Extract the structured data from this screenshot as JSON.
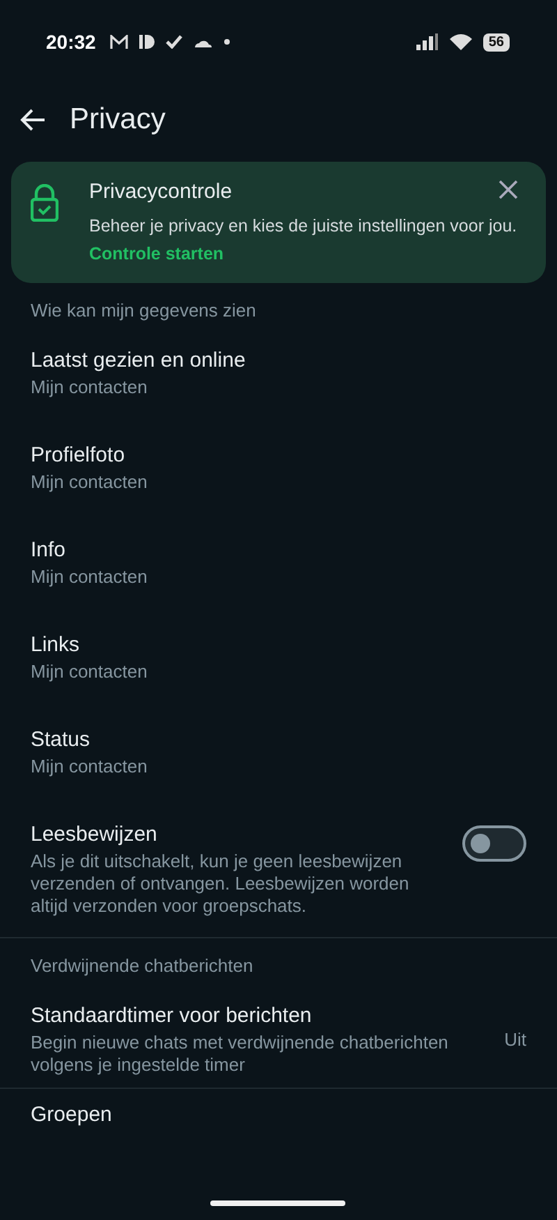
{
  "status_bar": {
    "time": "20:32",
    "battery": "56"
  },
  "header": {
    "title": "Privacy"
  },
  "banner": {
    "title": "Privacycontrole",
    "body": "Beheer je privacy en kies de juiste instellingen voor jou.",
    "link": "Controle starten"
  },
  "sections": [
    {
      "header": "Wie kan mijn gegevens zien",
      "items": [
        {
          "kind": "choice",
          "title": "Laatst gezien en online",
          "subtitle": "Mijn contacten"
        },
        {
          "kind": "choice",
          "title": "Profielfoto",
          "subtitle": "Mijn contacten"
        },
        {
          "kind": "choice",
          "title": "Info",
          "subtitle": "Mijn contacten"
        },
        {
          "kind": "choice",
          "title": "Links",
          "subtitle": "Mijn contacten"
        },
        {
          "kind": "choice",
          "title": "Status",
          "subtitle": "Mijn contacten"
        },
        {
          "kind": "toggle",
          "title": "Leesbewijzen",
          "subtitle": "Als je dit uitschakelt, kun je geen leesbewijzen verzenden of ontvangen. Leesbewijzen worden altijd verzonden voor groepschats.",
          "on": false
        }
      ]
    },
    {
      "header": "Verdwijnende chatberichten",
      "items": [
        {
          "kind": "value",
          "title": "Standaardtimer voor berichten",
          "subtitle": "Begin nieuwe chats met verdwijnende chatberichten volgens je ingestelde timer",
          "value": "Uit"
        }
      ]
    },
    {
      "items": [
        {
          "kind": "choice",
          "title": "Groepen"
        }
      ]
    }
  ]
}
